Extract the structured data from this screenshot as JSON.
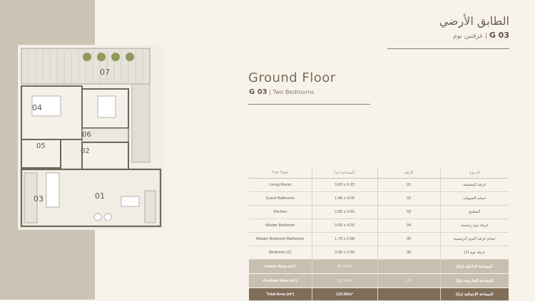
{
  "header": {
    "title_ar": "الطابق الأرضي",
    "code": "G 03",
    "subtitle_ar": "غرفتين نوم",
    "title_en": "Ground Floor",
    "subtitle_en": "Two Bedrooms"
  },
  "plan": {
    "labels": [
      "07",
      "04",
      "02",
      "06",
      "05",
      "03",
      "01"
    ]
  },
  "table": {
    "headers": [
      "The Type",
      "المساحة (م)",
      "الرقم",
      "النــوع"
    ],
    "rows": [
      {
        "type": "Living Room",
        "area": "3.60 x 6.23",
        "no": "01",
        "ar": "غرفة المعيشة"
      },
      {
        "type": "Guest Bathroom",
        "area": "1.68 x 3.00",
        "no": "02",
        "ar": "حمام الضيوف"
      },
      {
        "type": "Kitchen",
        "area": "2.85 x 3.60",
        "no": "03",
        "ar": "المطبخ"
      },
      {
        "type": "Master Bedroom",
        "area": "3.60 x 4.03",
        "no": "04",
        "ar": "غرفة نوم رئيسية"
      },
      {
        "type": "Master Bedroom Bathroom",
        "area": "1.70 x 2.68",
        "no": "05",
        "ar": "حمام غرفة النوم الرئيسية"
      },
      {
        "type": "Bedroom (1)",
        "area": "3.00 x 3.60",
        "no": "06",
        "ar": "غرفة نوم (1)"
      }
    ],
    "indoor": {
      "label": "Indoor Area (m²)",
      "value": "80.44m²",
      "ar": "المساحة الداخلية (م2)"
    },
    "outdoor": {
      "label": "Outdoor Area (m²)",
      "value": "30.32m²",
      "no": "07",
      "ar": "المساحة الخارجية (م2)"
    },
    "total": {
      "label": "Total Area (m²)",
      "value": "110.66m²",
      "ar": "المساحة الإجمالية (م2)"
    }
  }
}
